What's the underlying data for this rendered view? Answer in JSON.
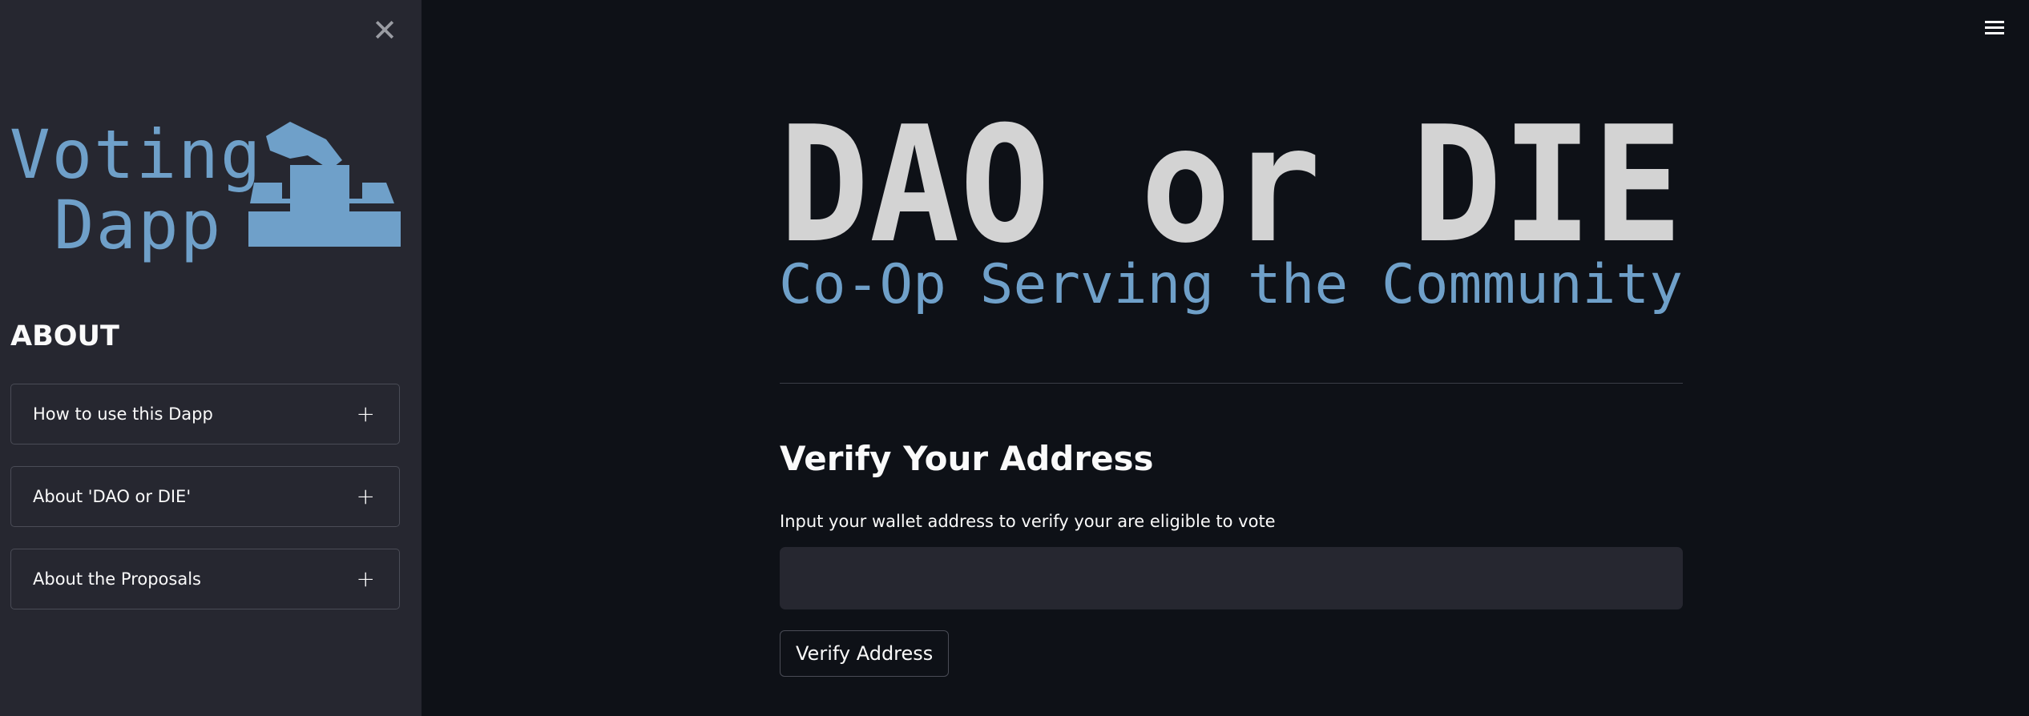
{
  "sidebar": {
    "close_icon": "close-icon",
    "logo": {
      "line1": "Voting",
      "line2": "Dapp",
      "icon": "ballot-box-icon",
      "color": "#6fa0c9"
    },
    "about_heading": "ABOUT",
    "expanders": [
      {
        "label": "How to use this Dapp",
        "icon": "plus-icon"
      },
      {
        "label": "About 'DAO or DIE'",
        "icon": "plus-icon"
      },
      {
        "label": "About the Proposals",
        "icon": "plus-icon"
      }
    ]
  },
  "header": {
    "menu_icon": "hamburger-menu-icon"
  },
  "banner": {
    "title": "DAO or DIE",
    "subtitle": "Co-Op Serving the Community",
    "title_color": "#d3d3d3",
    "subtitle_color": "#6fa0c9"
  },
  "verify": {
    "title": "Verify Your Address",
    "input_label": "Input your wallet address to verify your are eligible to vote",
    "input_value": "",
    "button_label": "Verify Address"
  },
  "colors": {
    "background": "#0e1117",
    "sidebar": "#262730",
    "text": "#fafafa",
    "accent": "#6fa0c9"
  }
}
